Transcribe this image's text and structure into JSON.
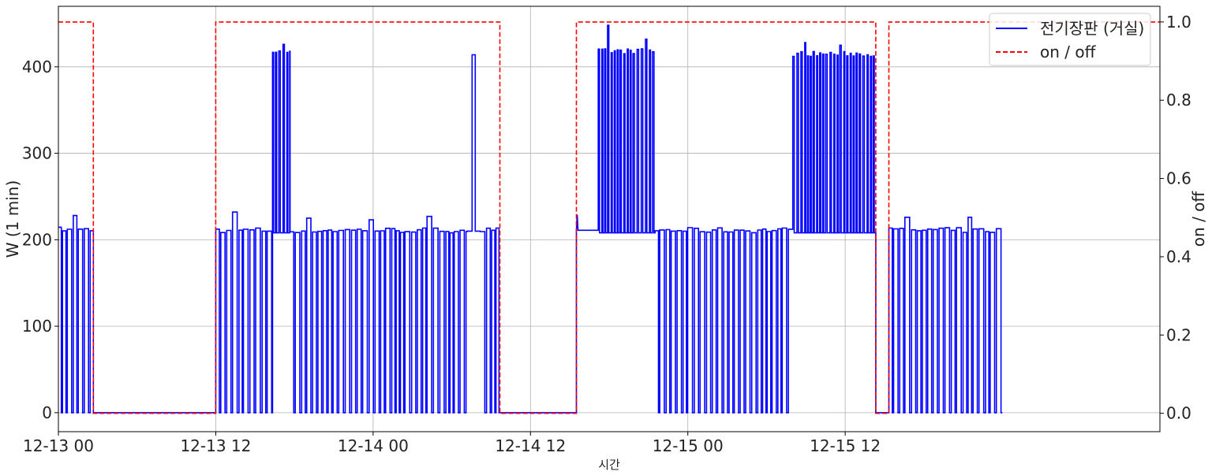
{
  "chart_data": {
    "type": "line",
    "title": "",
    "xlabel": "시간",
    "ylabel": "W (1 min)",
    "y2label": "on / off",
    "x_range": [
      "2022-12-13 00:00",
      "2022-12-16 12:00"
    ],
    "ylim": [
      -22,
      470
    ],
    "y2lim": [
      -0.047,
      1.04
    ],
    "x_ticks": [
      {
        "t": "2022-12-13 00:00",
        "label": "12-13 00"
      },
      {
        "t": "2022-12-13 12:00",
        "label": "12-13 12"
      },
      {
        "t": "2022-12-14 00:00",
        "label": "12-14 00"
      },
      {
        "t": "2022-12-14 12:00",
        "label": "12-14 12"
      },
      {
        "t": "2022-12-15 00:00",
        "label": "12-15 00"
      },
      {
        "t": "2022-12-15 12:00",
        "label": "12-15 12"
      }
    ],
    "y_ticks": [
      "0",
      "100",
      "200",
      "300",
      "400"
    ],
    "y2_ticks": [
      "0.0",
      "0.2",
      "0.4",
      "0.6",
      "0.8",
      "1.0"
    ],
    "grid": true,
    "legend_position": "top-right",
    "series": [
      {
        "name": "전기장판 (거실)",
        "axis": "left",
        "color": "#0000ff",
        "style": "solid",
        "values_note_free": true,
        "segments": [
          {
            "start": "2022-12-13 00:00",
            "end": "2022-12-13 02:40",
            "pattern": "cycling",
            "high": 212,
            "low": 0,
            "spikes": [
              228,
              225,
              182
            ]
          },
          {
            "start": "2022-12-13 02:40",
            "end": "2022-12-13 12:00",
            "pattern": "flat",
            "high": 0,
            "low": 0
          },
          {
            "start": "2022-12-13 12:00",
            "end": "2022-12-13 16:20",
            "pattern": "cycling",
            "high": 211,
            "low": 0,
            "spikes": [
              232,
              218,
              226
            ]
          },
          {
            "start": "2022-12-13 16:20",
            "end": "2022-12-13 17:40",
            "pattern": "high-cycling",
            "high": 418,
            "low": 208,
            "spikes": [
              426,
              425
            ]
          },
          {
            "start": "2022-12-13 17:40",
            "end": "2022-12-14 07:10",
            "pattern": "cycling",
            "high": 211,
            "low": 0,
            "spikes": [
              225,
              223,
              227,
              226,
              219
            ]
          },
          {
            "start": "2022-12-14 07:10",
            "end": "2022-12-14 08:10",
            "pattern": "spike",
            "high": 414,
            "low": 210
          },
          {
            "start": "2022-12-14 08:10",
            "end": "2022-12-14 09:40",
            "pattern": "cycling",
            "high": 211,
            "low": 0
          },
          {
            "start": "2022-12-14 09:40",
            "end": "2022-12-14 15:30",
            "pattern": "flat",
            "high": 0,
            "low": 0
          },
          {
            "start": "2022-12-14 15:30",
            "end": "2022-12-14 17:10",
            "pattern": "flat-on",
            "high": 211,
            "low": 208,
            "spikes": [
              229
            ]
          },
          {
            "start": "2022-12-14 17:10",
            "end": "2022-12-14 21:30",
            "pattern": "high-cycling",
            "high": 418,
            "low": 208,
            "spikes": [
              448,
              432
            ]
          },
          {
            "start": "2022-12-14 21:30",
            "end": "2022-12-15 08:00",
            "pattern": "cycling",
            "high": 211,
            "low": 0
          },
          {
            "start": "2022-12-15 08:00",
            "end": "2022-12-15 14:20",
            "pattern": "high-cycling",
            "high": 415,
            "low": 208,
            "spikes": [
              428,
              425
            ]
          },
          {
            "start": "2022-12-15 14:20",
            "end": "2022-12-15 15:20",
            "pattern": "flat",
            "high": 0,
            "low": 0
          },
          {
            "start": "2022-12-15 15:20",
            "end": "2022-12-15 23:59",
            "pattern": "cycling",
            "high": 211,
            "low": 0,
            "spikes": [
              226
            ]
          }
        ]
      },
      {
        "name": "on / off",
        "axis": "right",
        "color": "#ff0000",
        "style": "dashed",
        "steps": [
          {
            "start": "2022-12-13 00:00",
            "end": "2022-12-13 02:40",
            "value": 1
          },
          {
            "start": "2022-12-13 02:40",
            "end": "2022-12-13 12:00",
            "value": 0
          },
          {
            "start": "2022-12-13 12:00",
            "end": "2022-12-14 09:40",
            "value": 1
          },
          {
            "start": "2022-12-14 09:40",
            "end": "2022-12-14 15:30",
            "value": 0
          },
          {
            "start": "2022-12-14 15:30",
            "end": "2022-12-15 14:20",
            "value": 1
          },
          {
            "start": "2022-12-15 14:20",
            "end": "2022-12-15 15:20",
            "value": 0
          },
          {
            "start": "2022-12-15 15:20",
            "end": "2022-12-16 12:00",
            "value": 1
          }
        ]
      }
    ]
  }
}
